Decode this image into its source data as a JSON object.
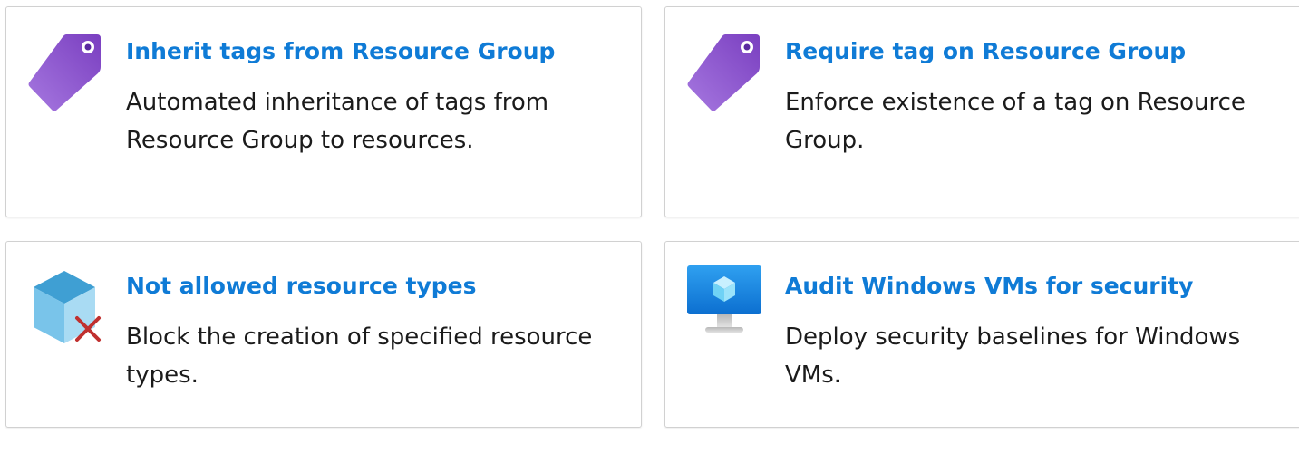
{
  "cards": [
    {
      "icon": "purple-tag-icon",
      "title": "Inherit tags from Resource Group",
      "description": "Automated inheritance of tags from Resource Group to resources."
    },
    {
      "icon": "purple-tag-icon",
      "title": "Require tag on Resource Group",
      "description": "Enforce existence of a tag on Resource Group."
    },
    {
      "icon": "blocked-cube-icon",
      "title": "Not allowed resource types",
      "description": "Block the creation of specified resource types."
    },
    {
      "icon": "virtual-machine-monitor-icon",
      "title": "Audit Windows VMs for security",
      "description": "Deploy security baselines for Windows VMs."
    }
  ],
  "colors": {
    "title": "#0f7bd6",
    "text": "#1b1b1b",
    "border": "#d1d1d1",
    "tag": "#8a52c9",
    "cube": "#3ea5d8",
    "block": "#c0302f",
    "monitor": "#1a8ae6"
  }
}
